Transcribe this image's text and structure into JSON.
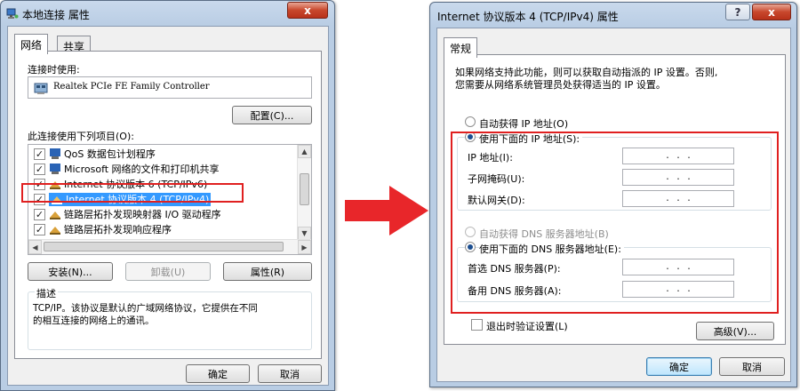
{
  "left_dialog": {
    "title": "本地连接 属性",
    "tabs": [
      "网络",
      "共享"
    ],
    "connect_using_label": "连接时使用:",
    "adapter_name": "Realtek PCIe FE Family Controller",
    "configure_button": "配置(C)...",
    "items_label": "此连接使用下列项目(O):",
    "items": [
      {
        "label": "QoS 数据包计划程序",
        "checked": true,
        "icon": "qos-icon"
      },
      {
        "label": "Microsoft 网络的文件和打印机共享",
        "checked": true,
        "icon": "share-icon"
      },
      {
        "label": "Internet 协议版本 6 (TCP/IPv6)",
        "checked": true,
        "icon": "protocol-icon"
      },
      {
        "label": "Internet 协议版本 4 (TCP/IPv4)",
        "checked": true,
        "icon": "protocol-icon",
        "selected": true
      },
      {
        "label": "链路层拓扑发现映射器 I/O 驱动程序",
        "checked": true,
        "icon": "protocol-icon"
      },
      {
        "label": "链路层拓扑发现响应程序",
        "checked": true,
        "icon": "protocol-icon"
      }
    ],
    "install_button": "安装(N)...",
    "uninstall_button": "卸载(U)",
    "properties_button": "属性(R)",
    "description_label": "描述",
    "description_text_line1": "TCP/IP。该协议是默认的广域网络协议，它提供在不同",
    "description_text_line2": "的相互连接的网络上的通讯。",
    "ok_button": "确定",
    "cancel_button": "取消",
    "close_glyph": "x"
  },
  "right_dialog": {
    "title": "Internet 协议版本 4 (TCP/IPv4) 属性",
    "tab": "常规",
    "help_glyph": "?",
    "close_glyph": "x",
    "intro_line1": "如果网络支持此功能，则可以获取自动指派的 IP 设置。否则,",
    "intro_line2": "您需要从网络系统管理员处获得适当的 IP 设置。",
    "auto_ip_radio": "自动获得 IP 地址(O)",
    "manual_ip_radio": "使用下面的 IP 地址(S):",
    "ip_address_label": "IP 地址(I):",
    "subnet_mask_label": "子网掩码(U):",
    "gateway_label": "默认网关(D):",
    "auto_dns_radio": "自动获得 DNS 服务器地址(B)",
    "manual_dns_radio": "使用下面的 DNS 服务器地址(E):",
    "preferred_dns_label": "首选 DNS 服务器(P):",
    "alternate_dns_label": "备用 DNS 服务器(A):",
    "ip_dots": ".      .      .",
    "validate_checkbox": "退出时验证设置(L)",
    "advanced_button": "高级(V)...",
    "ok_button": "确定",
    "cancel_button": "取消",
    "selected_mode": "manual"
  },
  "colors": {
    "highlight": "#e02020",
    "arrow": "#e8262a",
    "selection": "#3399ff"
  }
}
